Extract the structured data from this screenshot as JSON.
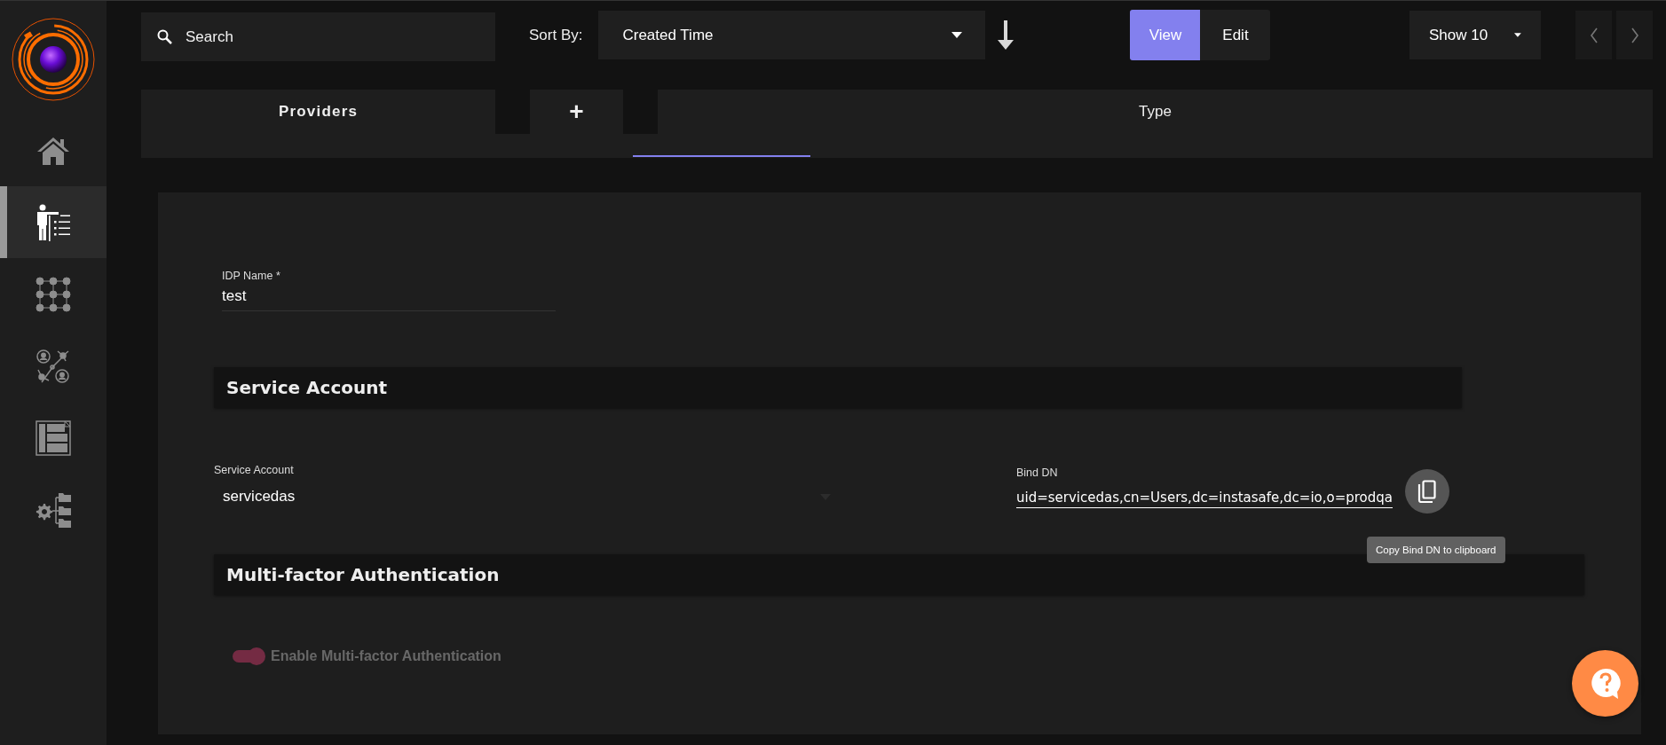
{
  "sidebar": {
    "items": [
      {
        "kind": "home",
        "selected": false
      },
      {
        "kind": "presenter",
        "selected": true
      },
      {
        "kind": "grid",
        "selected": false
      },
      {
        "kind": "network",
        "selected": false
      },
      {
        "kind": "layout",
        "selected": false
      },
      {
        "kind": "gear-folders",
        "selected": false
      }
    ]
  },
  "top_bar": {
    "search": {
      "placeholder": "Search"
    },
    "sort": {
      "label": "Sort By:",
      "value": "Created Time"
    },
    "mode_buttons": [
      {
        "label": "View",
        "selected": true
      },
      {
        "label": "Edit",
        "selected": false
      }
    ],
    "page_size": {
      "value": "Show 10"
    }
  },
  "tabs": [
    {
      "label": "Providers",
      "kind": "title"
    },
    {
      "label": "+",
      "kind": "add"
    },
    {
      "label": "Type",
      "kind": "column"
    }
  ],
  "form": {
    "idp_name": {
      "label": "IDP Name *",
      "value": "test"
    },
    "service_account_section": {
      "title": "Service Account"
    },
    "service_account": {
      "label": "Service Account",
      "value": "servicedas"
    },
    "bind_dn": {
      "label": "Bind DN",
      "value": "uid=servicedas,cn=Users,dc=instasafe,dc=io,o=prodqa",
      "tooltip": "Copy Bind DN to clipboard"
    },
    "mfa_section": {
      "title": "Multi-factor Authentication"
    },
    "mfa_toggle": {
      "label": "Enable Multi-factor Authentication",
      "on": true,
      "disabled": true
    }
  }
}
